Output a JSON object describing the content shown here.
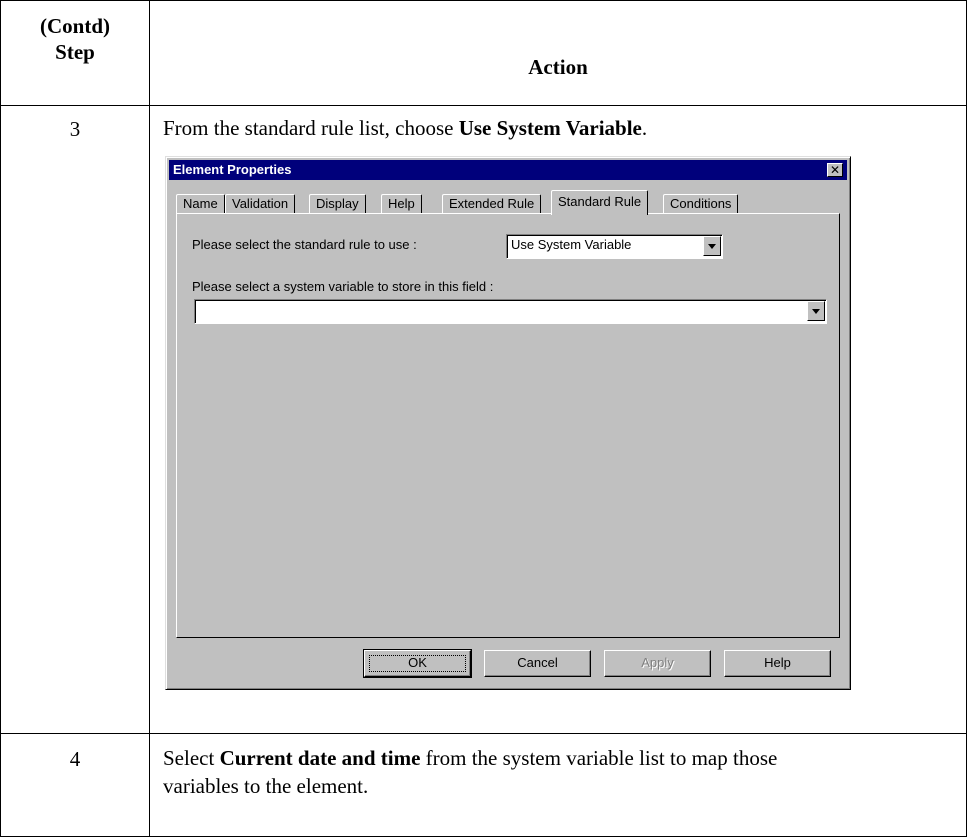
{
  "header": {
    "step_col": [
      "(Contd)",
      "Step"
    ],
    "action_col": "Action"
  },
  "rows": [
    {
      "step": "3",
      "text_before": "From the standard rule list, choose ",
      "text_bold": "Use System Variable",
      "text_after": "."
    },
    {
      "step": "4",
      "text_before": "Select ",
      "text_bold": "Current date and time",
      "text_after": " from the system variable list to map those",
      "text_line2": "variables to the element."
    }
  ],
  "dialog": {
    "title": "Element Properties",
    "close_glyph": "✕",
    "tabs": [
      "Name",
      "Validation",
      "Display",
      "Help",
      "Extended Rule",
      "Standard Rule",
      "Conditions"
    ],
    "active_tab": "Standard Rule",
    "rule_label": "Please select the standard rule to use :",
    "rule_value": "Use System Variable",
    "variable_label": "Please select a system variable to store in this field :",
    "variable_value": "",
    "buttons": {
      "ok": "OK",
      "cancel": "Cancel",
      "apply": "Apply",
      "help": "Help"
    }
  },
  "colors": {
    "titlebar": "#00007b",
    "dialog_face": "#c0c0c0"
  }
}
